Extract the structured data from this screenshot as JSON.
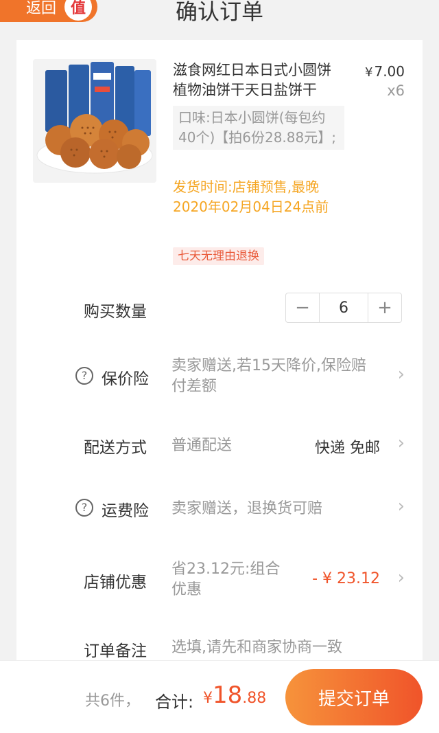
{
  "header": {
    "back_label": "返回",
    "badge_label": "值",
    "title": "确认订单"
  },
  "product": {
    "title": "滋食网红日本日式小圆饼植物油饼干天日盐饼干",
    "price_currency": "¥",
    "price": "7.00",
    "quantity_label": "x6",
    "sku": "口味:日本小圆饼(每包约40个)【拍6份28.88元】;",
    "ship_time": "发货时间:店铺预售,最晚2020年02月04日24点前",
    "return_tag": "七天无理由退换"
  },
  "rows": {
    "qty_label": "购买数量",
    "qty_value": "6",
    "qty_minus": "−",
    "qty_plus": "+",
    "price_protect_label": "保价险",
    "price_protect_value": "卖家赠送,若15天降价,保险赔付差额",
    "delivery_label": "配送方式",
    "delivery_value": "普通配送",
    "delivery_right": "快递 免邮",
    "freight_label": "运费险",
    "freight_value": "卖家赠送，退换货可赔",
    "discount_label": "店铺优惠",
    "discount_value": "省23.12元:组合优惠",
    "discount_amount": "- ¥ 23.12",
    "note_label": "订单备注",
    "note_placeholder": "选填,请先和商家协商一致",
    "help_glyph": "?",
    "chevron_glyph": "›"
  },
  "footer": {
    "count": "共6件，",
    "total_label": "合计:",
    "total_currency": "¥",
    "total_int": "18",
    "total_dec": ".88",
    "submit_label": "提交订单"
  }
}
